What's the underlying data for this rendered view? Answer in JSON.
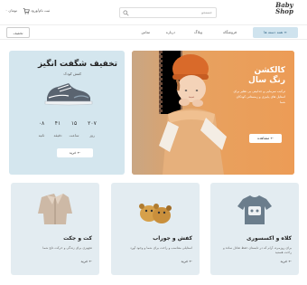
{
  "header": {
    "logo_line1": "Baby",
    "logo_line2": "Shop",
    "search_placeholder": "جستجو",
    "account_label": "ثبت نام/ورود",
    "cart_label": "۰ تومان"
  },
  "nav": {
    "categories_button": "همه دسته ها",
    "items": [
      "فروشگاه",
      "وبلاگ",
      "درباره",
      "تماس"
    ],
    "blog_button": "تخفیف"
  },
  "hero": {
    "title_line1": "کالکشن",
    "title_line2": "رنگ سال",
    "description": "ترکیب سرمایی و جذابیتی بی نظیر برای استایل های پاییزی و زمستانی کودکان شما",
    "button": "مشاهده"
  },
  "promo": {
    "title": "تخفیف شگفت انگیز",
    "subtitle": "کفش کودک",
    "countdown": [
      {
        "value": "۲۰۷",
        "label": "روز"
      },
      {
        "value": "۱۵",
        "label": "ساعت"
      },
      {
        "value": "۴۱",
        "label": "دقیقه"
      },
      {
        "value": "۰۸",
        "label": "ثانیه"
      }
    ],
    "button": "خرید"
  },
  "cards": [
    {
      "title": "کلاه و اکسسوری",
      "description": "برای روزمره، آرام که در تابستان حفظ تعادل ساده و راحت هستید",
      "buy": "خرید"
    },
    {
      "title": "کفش و جوراب",
      "description": "استایلی متناسب و راحت برای شما و وجود آورد",
      "buy": "خرید"
    },
    {
      "title": "کت و جکت",
      "description": "تجهیزی برای زندگی و حرکت دلخ شما",
      "buy": "خرید"
    }
  ],
  "colors": {
    "accent": "#cfe3ee",
    "hero_bg": "#e99f5f",
    "promo_bg": "#d4e6ee",
    "card_bg": "#e6eef2"
  }
}
